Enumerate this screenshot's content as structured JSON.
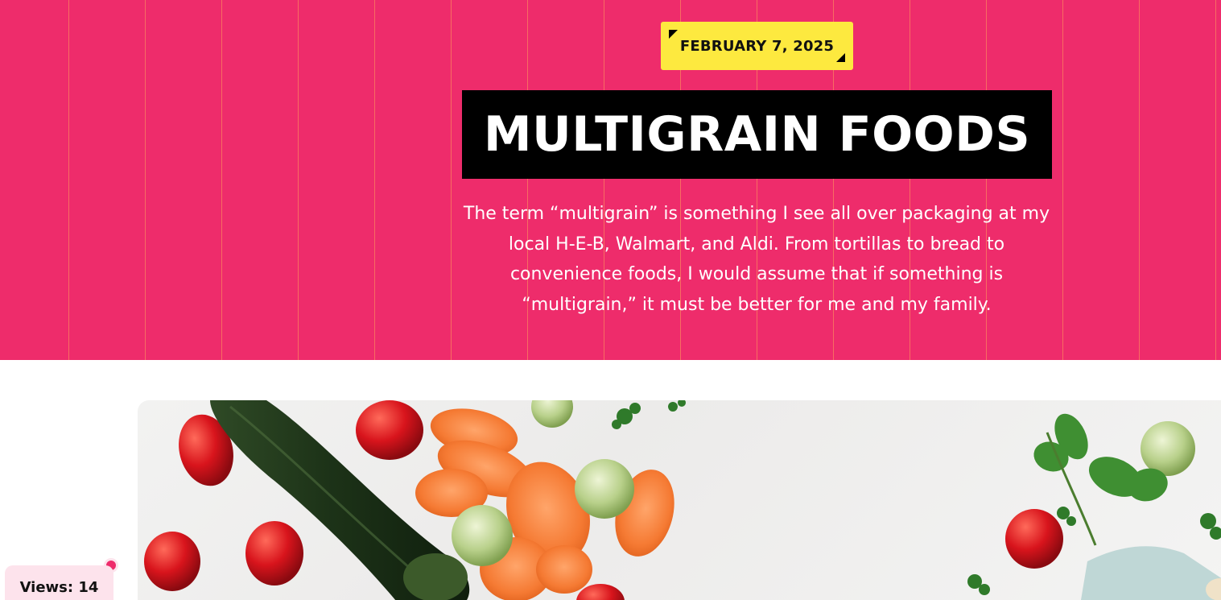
{
  "post": {
    "date": "FEBRUARY 7, 2025",
    "title": "MULTIGRAIN FOODS",
    "intro_lines": [
      "The term “multigrain” is something I see all over packaging at my",
      "local H-E-B, Walmart, and Aldi. From tortillas to bread to",
      "convenience foods, I would assume that if something is",
      "“multigrain,” it must be better for me and my family."
    ]
  },
  "featured_image": {
    "icon": "vegetables-photo"
  },
  "views": {
    "label": "Views: 14"
  },
  "colors": {
    "hero_background": "#ee2c6b",
    "date_badge": "#fde93f",
    "title_background": "#000000",
    "views_badge": "#fde3ec",
    "views_dot": "#ee2c6b"
  }
}
